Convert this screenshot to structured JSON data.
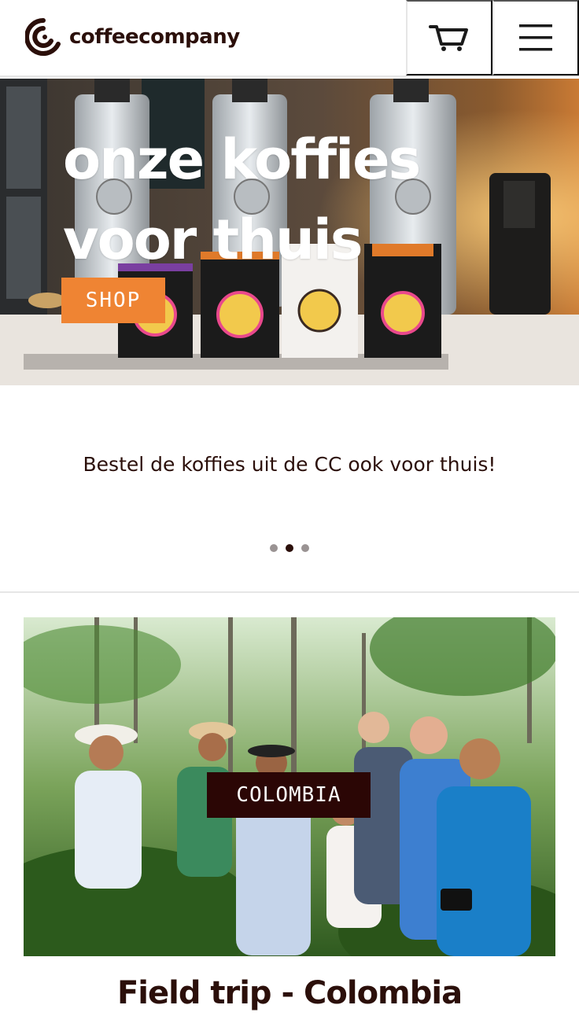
{
  "header": {
    "brand": "coffeecompany",
    "cart_icon": "shopping-cart-icon",
    "menu_icon": "hamburger-menu-icon"
  },
  "hero": {
    "title_line1": "onze koffies",
    "title_line2": "voor thuis",
    "cta_label": "SHOP",
    "cta_color": "#ef8433"
  },
  "slider": {
    "caption": "Bestel de koffies uit de CC ook voor thuis!",
    "dot_count": 3,
    "active_index": 1
  },
  "card": {
    "tag": "COLOMBIA",
    "title": "Field trip - Colombia"
  },
  "colors": {
    "brand_dark": "#2b0f0a",
    "accent": "#ef8433"
  }
}
